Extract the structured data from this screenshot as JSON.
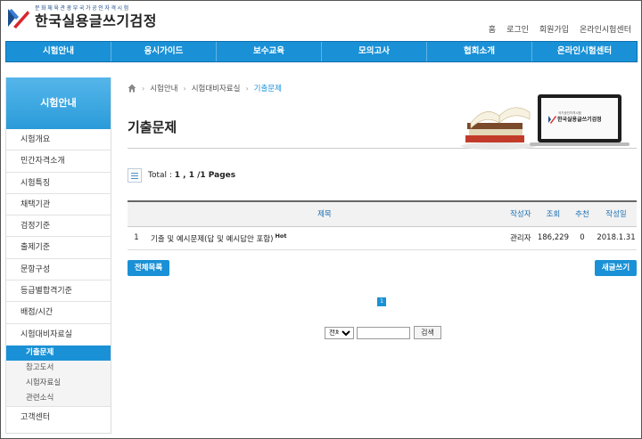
{
  "header": {
    "logo_sub": "문화체육관광부국가공인자격시험",
    "logo_title": "한국실용글쓰기검정",
    "top_links": [
      "홈",
      "로그인",
      "회원가입",
      "온라인시험센터"
    ]
  },
  "nav": [
    "시험안내",
    "응시가이드",
    "보수교육",
    "모의고사",
    "협회소개",
    "온라인시험센터"
  ],
  "sidebar": {
    "title": "시험안내",
    "items": [
      "시험개요",
      "민간자격소개",
      "시험특징",
      "채택기관",
      "검정기준",
      "출제기준",
      "문항구성",
      "등급별합격기준",
      "배점/시간",
      "시험대비자료실"
    ],
    "sub_items": [
      "기출문제",
      "참고도서",
      "시험자료실",
      "관련소식"
    ],
    "active_sub": "기출문제",
    "last_item": "고객센터"
  },
  "breadcrumb": [
    "시험안내",
    "시험대비자료실",
    "기출문제"
  ],
  "page_title": "기출문제",
  "illustration": {
    "screen_small": "국가공인자격시험",
    "screen_title": "한국실용글쓰기검정"
  },
  "total": {
    "label": "Total : ",
    "value": "1 , 1 /1 Pages"
  },
  "table": {
    "columns": [
      "제목",
      "작성자",
      "조회",
      "추천",
      "작성일"
    ],
    "rows": [
      {
        "no": "1",
        "title": "기출 및 예시문제(답 및 예시답안 포함)",
        "badge": "Hot",
        "author": "관리자",
        "views": "186,229",
        "likes": "0",
        "date": "2018.1.31"
      }
    ]
  },
  "buttons": {
    "list_all": "전체목록",
    "write": "새글쓰기"
  },
  "pagination": {
    "current": "1"
  },
  "search": {
    "option": "전체",
    "button": "검색"
  },
  "colors": {
    "primary": "#1a91d6",
    "brand_red": "#d8262c",
    "brand_navy": "#1a4c8c"
  }
}
